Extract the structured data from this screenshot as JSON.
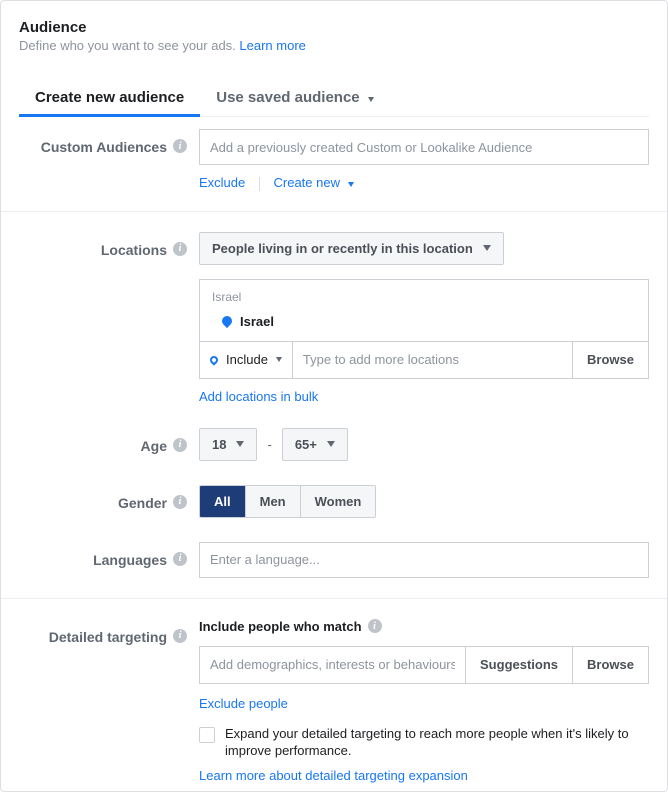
{
  "header": {
    "title": "Audience",
    "subtitle": "Define who you want to see your ads. ",
    "learn_more": "Learn more"
  },
  "tabs": {
    "create": "Create new audience",
    "saved": "Use saved audience"
  },
  "custom": {
    "label": "Custom Audiences",
    "placeholder": "Add a previously created Custom or Lookalike Audience",
    "exclude": "Exclude",
    "create_new": "Create new"
  },
  "locations": {
    "label": "Locations",
    "scope": "People living in or recently in this location",
    "group_label": "Israel",
    "item": "Israel",
    "include": "Include",
    "input_placeholder": "Type to add more locations",
    "browse": "Browse",
    "bulk": "Add locations in bulk"
  },
  "age": {
    "label": "Age",
    "min": "18",
    "max": "65+"
  },
  "gender": {
    "label": "Gender",
    "all": "All",
    "men": "Men",
    "women": "Women"
  },
  "languages": {
    "label": "Languages",
    "placeholder": "Enter a language..."
  },
  "detailed": {
    "label": "Detailed targeting",
    "include_label": "Include people who match",
    "placeholder": "Add demographics, interests or behaviours",
    "suggestions": "Suggestions",
    "browse": "Browse",
    "exclude": "Exclude people",
    "expand_text": "Expand your detailed targeting to reach more people when it's likely to improve performance.",
    "learn_expand": "Learn more about detailed targeting expansion"
  }
}
